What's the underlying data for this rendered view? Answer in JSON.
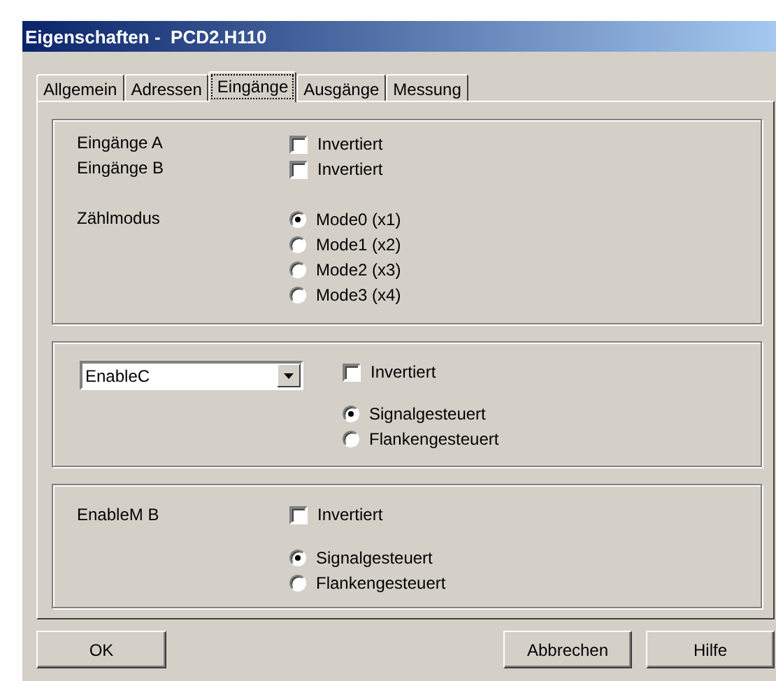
{
  "window": {
    "title": "Eigenschaften -  PCD2.H110"
  },
  "tabs": [
    {
      "label": "Allgemein",
      "selected": false
    },
    {
      "label": "Adressen",
      "selected": false
    },
    {
      "label": "Eingänge",
      "selected": true
    },
    {
      "label": "Ausgänge",
      "selected": false
    },
    {
      "label": "Messung",
      "selected": false
    }
  ],
  "groups": [
    {
      "kind": "inputs",
      "rows": [
        {
          "label": "Eingänge A",
          "invert": {
            "label": "Invertiert",
            "checked": false
          }
        },
        {
          "label": "Eingänge B",
          "invert": {
            "label": "Invertiert",
            "checked": false
          }
        }
      ],
      "count_mode": {
        "label": "Zählmodus",
        "options": [
          {
            "label": "Mode0 (x1)",
            "selected": true
          },
          {
            "label": "Mode1 (x2)",
            "selected": false
          },
          {
            "label": "Mode2 (x3)",
            "selected": false
          },
          {
            "label": "Mode3 (x4)",
            "selected": false
          }
        ]
      }
    },
    {
      "kind": "enable",
      "combo": {
        "value": "EnableC"
      },
      "invert": {
        "label": "Invertiert",
        "checked": false
      },
      "options": [
        {
          "label": "Signalgesteuert",
          "selected": true
        },
        {
          "label": "Flankengesteuert",
          "selected": false
        }
      ]
    },
    {
      "kind": "enable",
      "label": "EnableM B",
      "invert": {
        "label": "Invertiert",
        "checked": false
      },
      "options": [
        {
          "label": "Signalgesteuert",
          "selected": true
        },
        {
          "label": "Flankengesteuert",
          "selected": false
        }
      ]
    }
  ],
  "buttons": [
    {
      "label": "OK"
    },
    {
      "label": "Abbrechen"
    },
    {
      "label": "Hilfe"
    }
  ]
}
